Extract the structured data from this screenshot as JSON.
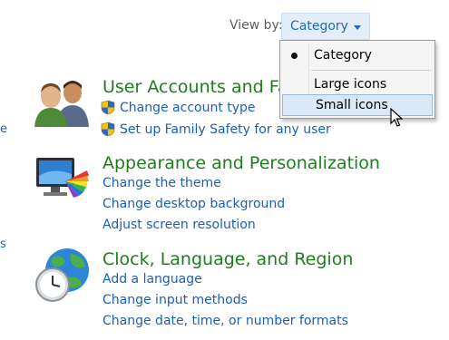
{
  "view_by": {
    "label": "View by:",
    "selected": "Category",
    "options": [
      "Category",
      "Large icons",
      "Small icons"
    ]
  },
  "groups": [
    {
      "title": "User Accounts and Family Safety",
      "links": [
        "Change account type",
        "Set up Family Safety for any user"
      ]
    },
    {
      "title": "Appearance and Personalization",
      "links": [
        "Change the theme",
        "Change desktop background",
        "Adjust screen resolution"
      ]
    },
    {
      "title": "Clock, Language, and Region",
      "links": [
        "Add a language",
        "Change input methods",
        "Change date, time, or number formats"
      ]
    }
  ],
  "left_edge": [
    "e",
    "s"
  ],
  "colors": {
    "link": "#1a5fb4",
    "group_title": "#1e7e1e",
    "menu_highlight": "#dbe8f8"
  }
}
